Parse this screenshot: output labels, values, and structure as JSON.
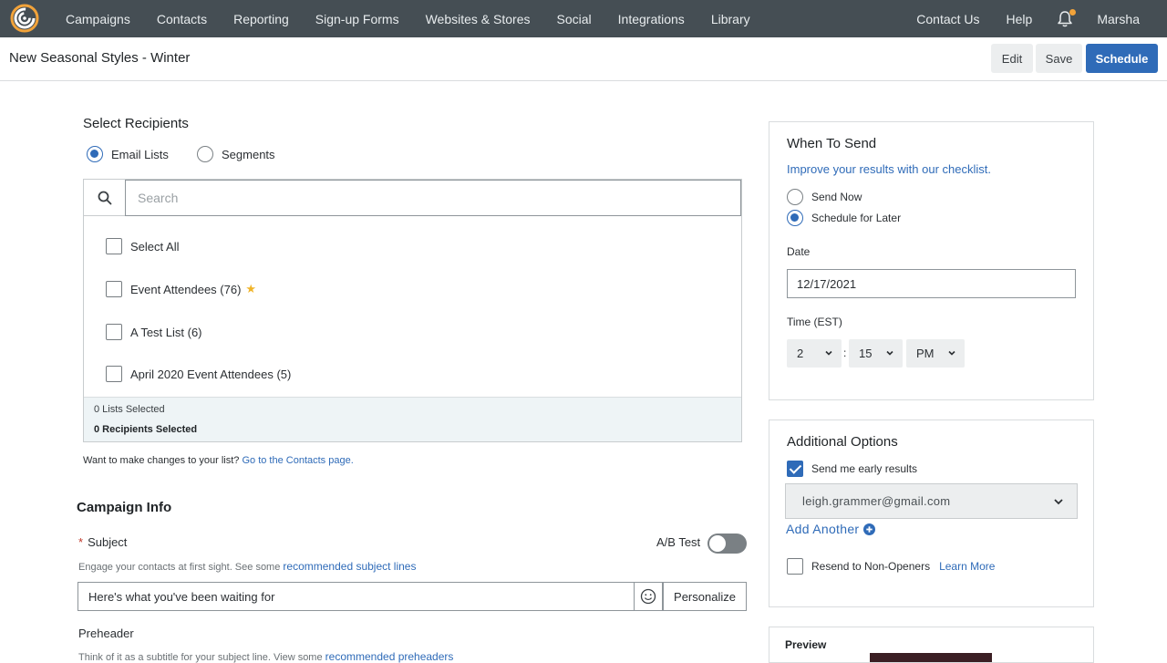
{
  "nav": {
    "items": [
      "Campaigns",
      "Contacts",
      "Reporting",
      "Sign-up Forms",
      "Websites & Stores",
      "Social",
      "Integrations",
      "Library"
    ],
    "contact_us": "Contact Us",
    "help": "Help",
    "user": "Marsha"
  },
  "titlebar": {
    "title": "New Seasonal Styles - Winter",
    "edit": "Edit",
    "save": "Save",
    "schedule": "Schedule"
  },
  "recipients": {
    "heading": "Select Recipients",
    "radio_email_lists": "Email Lists",
    "radio_segments": "Segments",
    "search_placeholder": "Search",
    "select_all": "Select All",
    "lists": [
      "Event Attendees (76)",
      "A Test List (6)",
      "April 2020 Event Attendees (5)"
    ],
    "lists_selected": "0 Lists Selected",
    "recipients_selected": "0 Recipients Selected",
    "changes_text": "Want to make changes to your list?",
    "changes_link": "Go to the Contacts page."
  },
  "campaign": {
    "heading": "Campaign Info",
    "subject_label": "Subject",
    "required_mark": "*",
    "ab_test": "A/B Test",
    "engage_text": "Engage your contacts at first sight. See some",
    "engage_link": "recommended subject lines",
    "subject_value": "Here's what you've been waiting for",
    "personalize": "Personalize",
    "preheader_label": "Preheader",
    "preheader_hint": "Think of it as a subtitle for your subject line. View some",
    "preheader_link": "recommended preheaders"
  },
  "when": {
    "heading": "When To Send",
    "checklist_link": "Improve your results with our checklist.",
    "send_now": "Send Now",
    "schedule_later": "Schedule for Later",
    "date_label": "Date",
    "date_value": "12/17/2021",
    "time_label": "Time (EST)",
    "hour": "2",
    "colon": ":",
    "minute": "15",
    "ampm": "PM"
  },
  "additional": {
    "heading": "Additional Options",
    "early_results": "Send me early results",
    "email": "leigh.grammer@gmail.com",
    "add_another": "Add Another",
    "resend": "Resend to Non-Openers",
    "learn_more": "Learn More"
  },
  "preview": {
    "heading": "Preview"
  },
  "colors": {
    "nav_bg": "#454e54",
    "accent": "#2f6bb8",
    "logo_orange": "#f2a33a"
  }
}
